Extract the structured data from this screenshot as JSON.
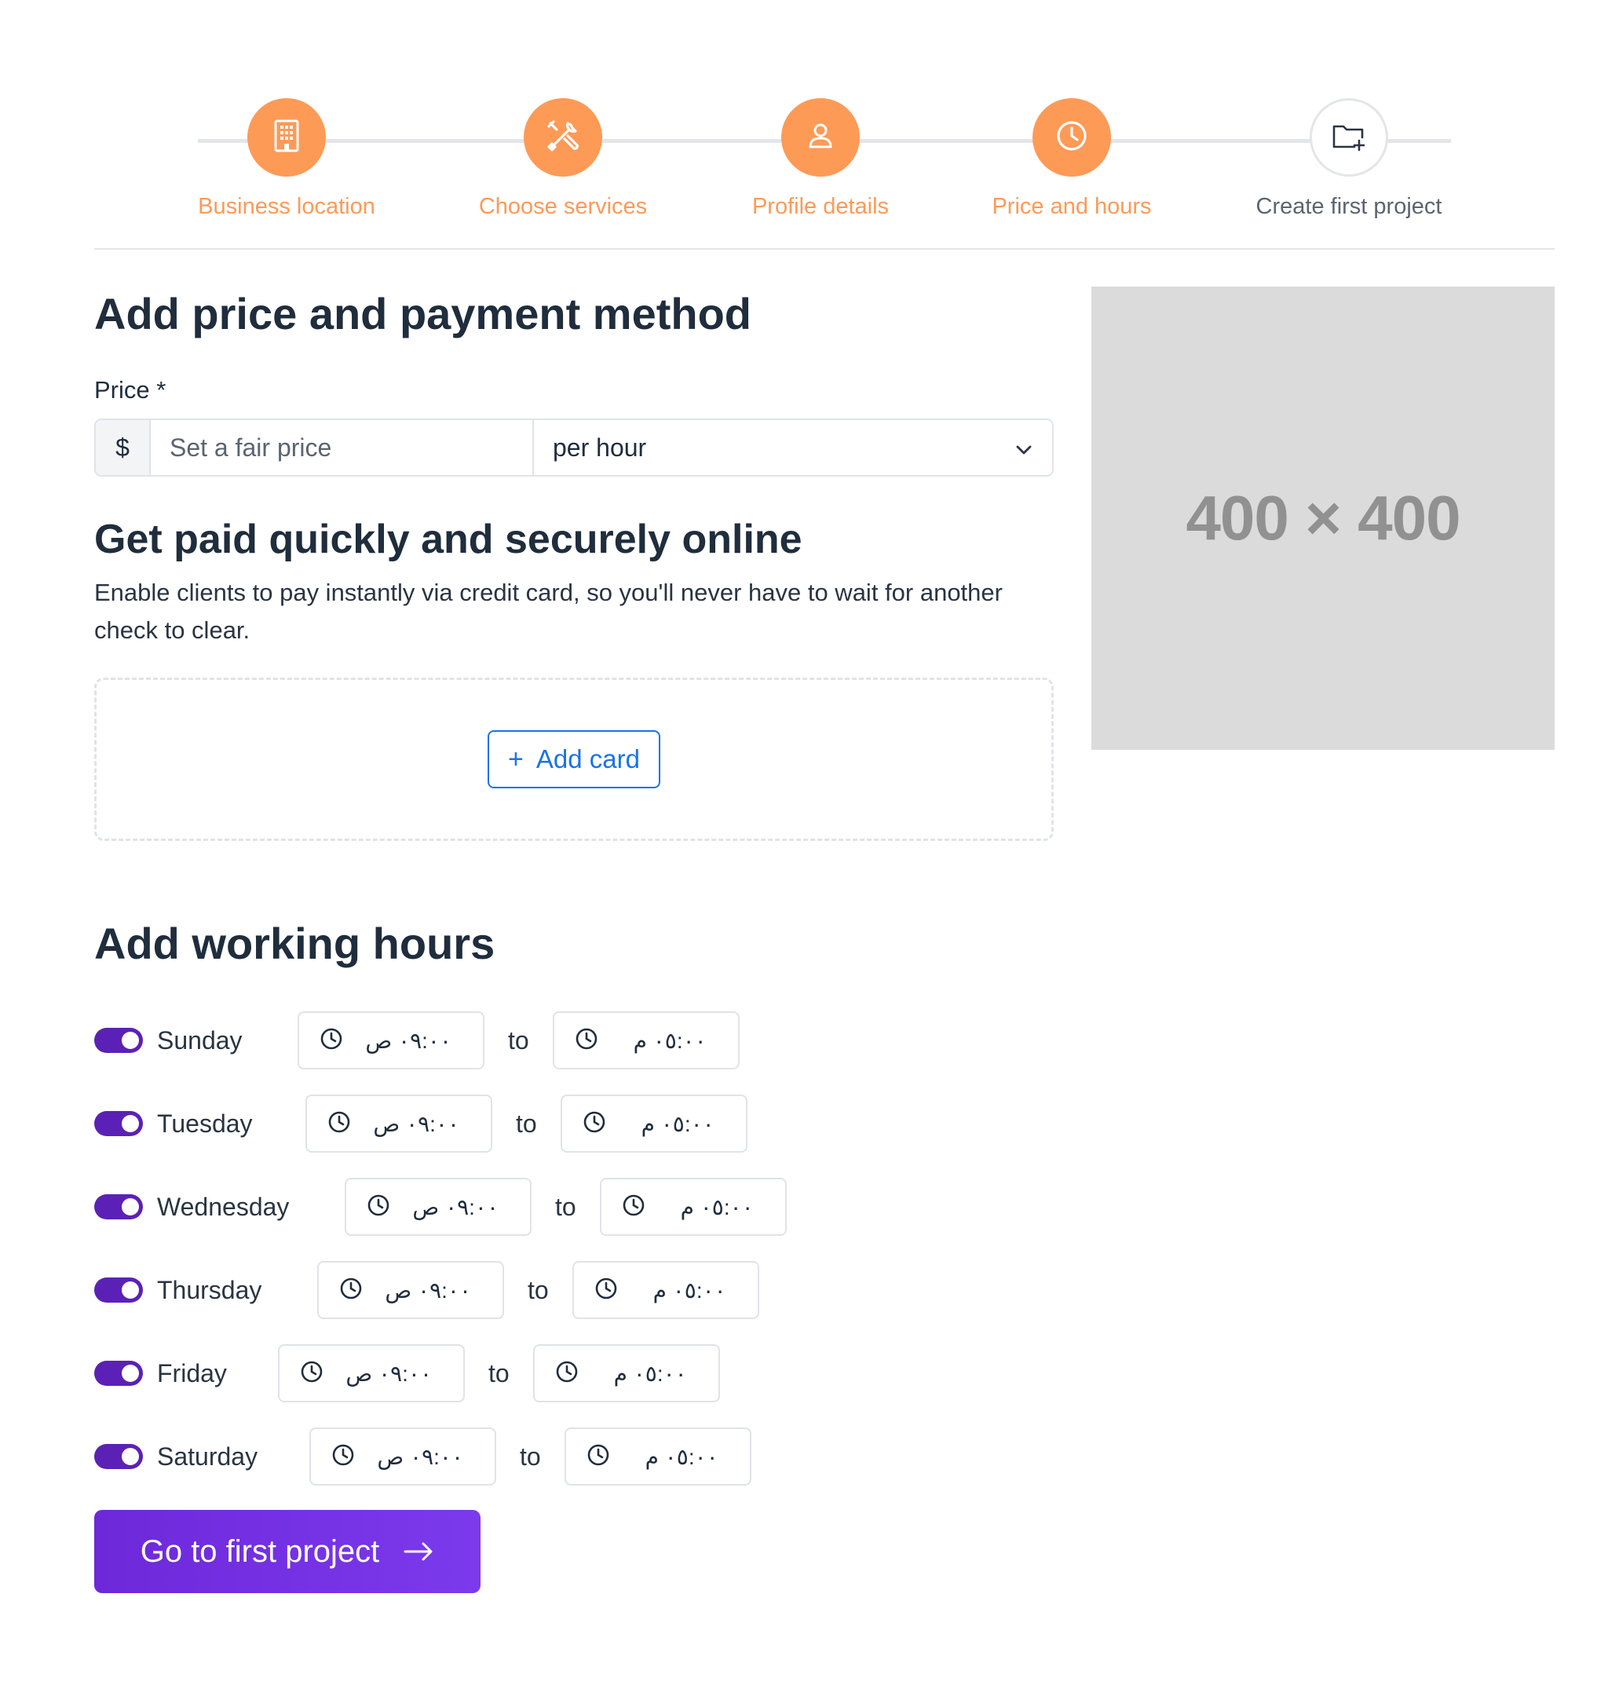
{
  "stepper": {
    "steps": [
      {
        "label": "Business location",
        "icon": "building-icon",
        "state": "done"
      },
      {
        "label": "Choose services",
        "icon": "tools-icon",
        "state": "done"
      },
      {
        "label": "Profile details",
        "icon": "user-icon",
        "state": "done"
      },
      {
        "label": "Price and hours",
        "icon": "clock-icon",
        "state": "done"
      },
      {
        "label": "Create first project",
        "icon": "folder-plus-icon",
        "state": "pending"
      }
    ],
    "accent_color": "#fd9a56"
  },
  "placeholder": {
    "text": "400 × 400"
  },
  "main": {
    "title": "Add price and payment method",
    "price": {
      "label": "Price *",
      "prefix": "$",
      "placeholder": "Set a fair price",
      "value": "",
      "unit_selected": "per hour"
    },
    "payment": {
      "title": "Get paid quickly and securely online",
      "description": "Enable clients to pay instantly via credit card, so you'll never have to wait for another check to clear.",
      "add_card_label": "Add card",
      "add_card_icon": "+"
    },
    "hours": {
      "title": "Add working hours",
      "to_label": "to",
      "days": [
        {
          "day": "Sunday",
          "enabled": true,
          "from": "٠٩:٠٠ ص",
          "to": "٠٥:٠٠ م"
        },
        {
          "day": "Tuesday",
          "enabled": true,
          "from": "٠٩:٠٠ ص",
          "to": "٠٥:٠٠ م"
        },
        {
          "day": "Wednesday",
          "enabled": true,
          "from": "٠٩:٠٠ ص",
          "to": "٠٥:٠٠ م"
        },
        {
          "day": "Thursday",
          "enabled": true,
          "from": "٠٩:٠٠ ص",
          "to": "٠٥:٠٠ م"
        },
        {
          "day": "Friday",
          "enabled": true,
          "from": "٠٩:٠٠ ص",
          "to": "٠٥:٠٠ م"
        },
        {
          "day": "Saturday",
          "enabled": true,
          "from": "٠٩:٠٠ ص",
          "to": "٠٥:٠٠ م"
        }
      ]
    },
    "cta_label": "Go to first project",
    "colors": {
      "toggle": "#5b21b6",
      "cta": "#7c3aed",
      "link": "#1a73e8"
    }
  }
}
